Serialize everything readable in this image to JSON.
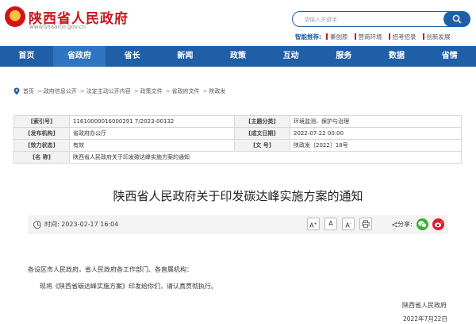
{
  "header": {
    "site_title": "陕西省人民政府",
    "site_url": "www.shaanxi.gov.cn",
    "search_placeholder": "请输入关键字",
    "recommend_label": "智能推荐:",
    "recommend_items": [
      "秦创原",
      "营商环境",
      "招考招录",
      "创新发展"
    ]
  },
  "nav": {
    "items": [
      "首页",
      "省政府",
      "省长",
      "新闻",
      "政策",
      "互动",
      "服务",
      "数据",
      "省情"
    ],
    "active_index": 1
  },
  "breadcrumb": [
    "首页",
    "政府信息公开",
    "法定主动公开内容",
    "政策文件",
    "省政府文件",
    "陕政发"
  ],
  "info": {
    "index_label": "[索引号]",
    "index_value": "11610000016000291 7/2023-00132",
    "topic_label": "[主题分类]",
    "topic_value": "环境监测、保护与治理",
    "issuer_label": "[发布机构]",
    "issuer_value": "省政府办公厅",
    "date_label": "[成文日期]",
    "date_value": "2022-07-22 00:00",
    "validity_label": "[效力状态]",
    "validity_value": "有效",
    "docno_label": "[文 号]",
    "docno_value": "陕政发〔2022〕18号",
    "name_label": "[名 称]",
    "name_value": "陕西省人民政府关于印发碳达峰实施方案的通知"
  },
  "article": {
    "title": "陕西省人民政府关于印发碳达峰实施方案的通知",
    "time_text": "时间: 2023-02-17 16:04",
    "font_large": "A",
    "font_mid": "A",
    "font_small": "A",
    "share_label": "分享:",
    "para1": "各设区市人民政府，省人民政府各工作部门、各直属机构：",
    "para2": "现将《陕西省碳达峰实施方案》印发给你们，请认真贯彻执行。",
    "sign_org": "陕西省人民政府",
    "sign_date": "2022年7月22日"
  },
  "colors": {
    "brand_red": "#c8161d",
    "brand_blue": "#1f5fa8"
  }
}
